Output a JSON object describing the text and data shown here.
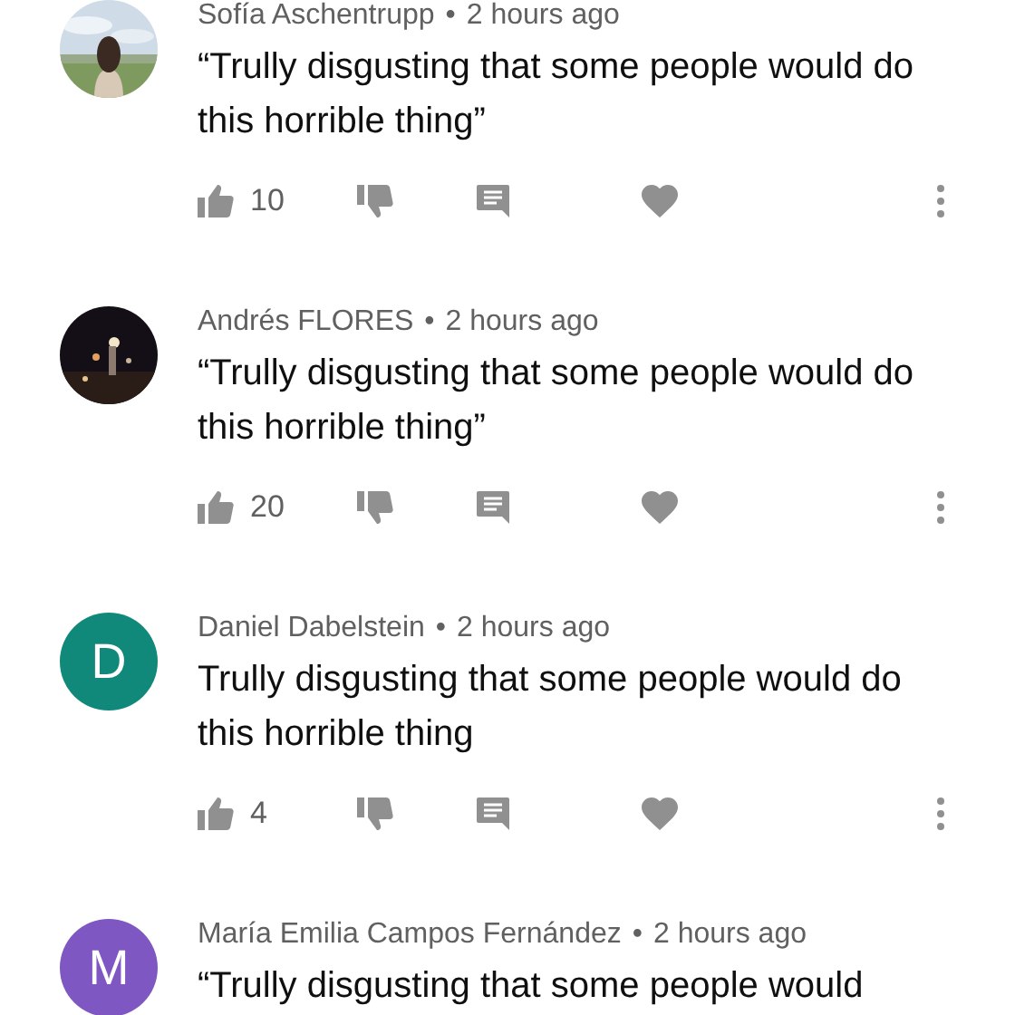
{
  "comments": [
    {
      "author": "Sofía Aschentrupp",
      "separator": "•",
      "time": "2 hours ago",
      "text": "“Trully disgusting that some people would do this horrible thing”",
      "likes": "10"
    },
    {
      "author": "Andrés FLORES",
      "separator": "•",
      "time": "2 hours ago",
      "text": "“Trully disgusting that some people would do this horrible thing”",
      "likes": "20"
    },
    {
      "author": "Daniel Dabelstein",
      "separator": "•",
      "time": "2 hours ago",
      "text": "Trully disgusting that some people would do this horrible thing",
      "likes": "4",
      "avatar": {
        "kind": "letter",
        "letter": "D",
        "color": "#11897a"
      }
    },
    {
      "author": "María Emilia Campos Fernández",
      "separator": "•",
      "time": "2 hours ago",
      "text": "“Trully disgusting that some people would",
      "avatar": {
        "kind": "letter",
        "letter": "M",
        "color": "#7e57c2"
      }
    }
  ]
}
